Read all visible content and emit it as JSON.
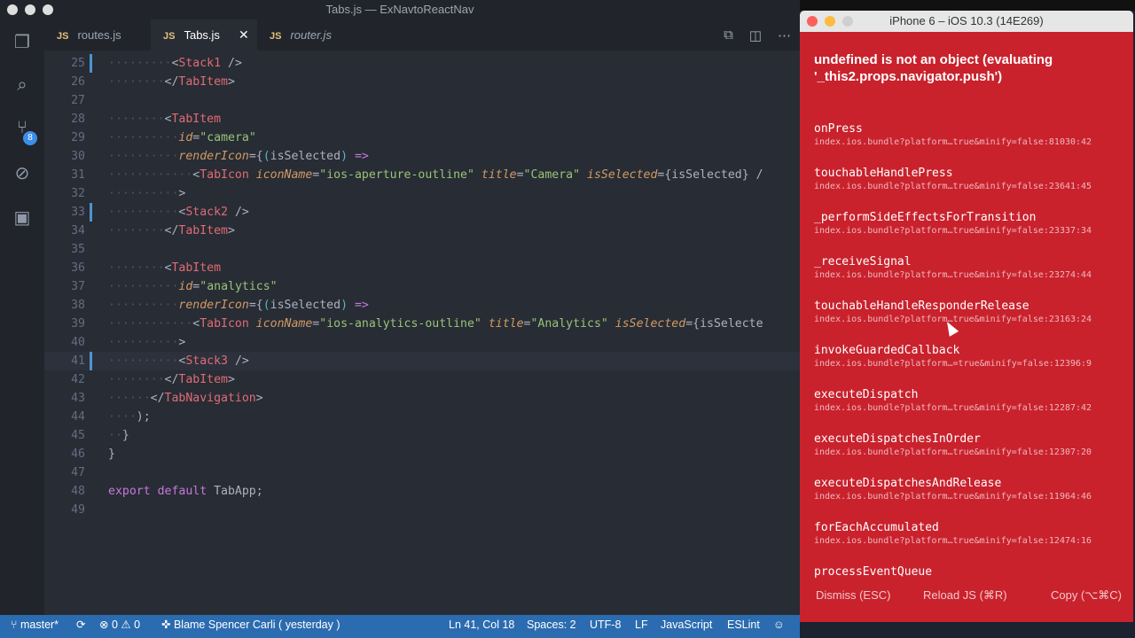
{
  "window_title": "Tabs.js — ExNavtoReactNav",
  "tabs": [
    {
      "label": "routes.js",
      "icon": "JS"
    },
    {
      "label": "Tabs.js",
      "icon": "JS"
    },
    {
      "label": "router.js",
      "icon": "JS"
    }
  ],
  "scm_badge": "8",
  "lines": [
    {
      "n": "25",
      "segs": [
        [
          "g",
          "·········"
        ],
        [
          "p",
          "<"
        ],
        [
          "t",
          "Stack1"
        ],
        [
          "p",
          " />"
        ]
      ]
    },
    {
      "n": "26",
      "segs": [
        [
          "g",
          "········"
        ],
        [
          "p",
          "</"
        ],
        [
          "t",
          "TabItem"
        ],
        [
          "p",
          ">"
        ]
      ]
    },
    {
      "n": "27",
      "segs": []
    },
    {
      "n": "28",
      "segs": [
        [
          "g",
          "········"
        ],
        [
          "p",
          "<"
        ],
        [
          "t",
          "TabItem"
        ]
      ]
    },
    {
      "n": "29",
      "segs": [
        [
          "g",
          "··········"
        ],
        [
          "a",
          "id"
        ],
        [
          "p",
          "="
        ],
        [
          "s",
          "\"camera\""
        ]
      ]
    },
    {
      "n": "30",
      "segs": [
        [
          "g",
          "··········"
        ],
        [
          "a",
          "renderIcon"
        ],
        [
          "p",
          "={"
        ],
        [
          "w",
          "("
        ],
        [
          "p",
          "isSelected"
        ],
        [
          "w",
          ")"
        ],
        [
          "k",
          " =>"
        ]
      ]
    },
    {
      "n": "31",
      "segs": [
        [
          "g",
          "············"
        ],
        [
          "p",
          "<"
        ],
        [
          "t",
          "TabIcon"
        ],
        [
          "p",
          " "
        ],
        [
          "a",
          "iconName"
        ],
        [
          "p",
          "="
        ],
        [
          "s",
          "\"ios-aperture-outline\""
        ],
        [
          "p",
          " "
        ],
        [
          "a",
          "title"
        ],
        [
          "p",
          "="
        ],
        [
          "s",
          "\"Camera\""
        ],
        [
          "p",
          " "
        ],
        [
          "a",
          "isSelected"
        ],
        [
          "p",
          "={isSelected} /"
        ]
      ]
    },
    {
      "n": "32",
      "segs": [
        [
          "g",
          "··········"
        ],
        [
          "p",
          ">"
        ]
      ]
    },
    {
      "n": "33",
      "segs": [
        [
          "g",
          "··········"
        ],
        [
          "p",
          "<"
        ],
        [
          "t",
          "Stack2"
        ],
        [
          "p",
          " />"
        ]
      ]
    },
    {
      "n": "34",
      "segs": [
        [
          "g",
          "········"
        ],
        [
          "p",
          "</"
        ],
        [
          "t",
          "TabItem"
        ],
        [
          "p",
          ">"
        ]
      ]
    },
    {
      "n": "35",
      "segs": []
    },
    {
      "n": "36",
      "segs": [
        [
          "g",
          "········"
        ],
        [
          "p",
          "<"
        ],
        [
          "t",
          "TabItem"
        ]
      ]
    },
    {
      "n": "37",
      "segs": [
        [
          "g",
          "··········"
        ],
        [
          "a",
          "id"
        ],
        [
          "p",
          "="
        ],
        [
          "s",
          "\"analytics\""
        ]
      ]
    },
    {
      "n": "38",
      "segs": [
        [
          "g",
          "··········"
        ],
        [
          "a",
          "renderIcon"
        ],
        [
          "p",
          "={"
        ],
        [
          "w",
          "("
        ],
        [
          "p",
          "isSelected"
        ],
        [
          "w",
          ")"
        ],
        [
          "k",
          " =>"
        ]
      ]
    },
    {
      "n": "39",
      "segs": [
        [
          "g",
          "············"
        ],
        [
          "p",
          "<"
        ],
        [
          "t",
          "TabIcon"
        ],
        [
          "p",
          " "
        ],
        [
          "a",
          "iconName"
        ],
        [
          "p",
          "="
        ],
        [
          "s",
          "\"ios-analytics-outline\""
        ],
        [
          "p",
          " "
        ],
        [
          "a",
          "title"
        ],
        [
          "p",
          "="
        ],
        [
          "s",
          "\"Analytics\""
        ],
        [
          "p",
          " "
        ],
        [
          "a",
          "isSelected"
        ],
        [
          "p",
          "={isSelecte"
        ]
      ]
    },
    {
      "n": "40",
      "segs": [
        [
          "g",
          "··········"
        ],
        [
          "p",
          ">"
        ]
      ]
    },
    {
      "n": "41",
      "segs": [
        [
          "g",
          "··········"
        ],
        [
          "p",
          "<"
        ],
        [
          "t",
          "Stack3"
        ],
        [
          "p",
          " />"
        ]
      ]
    },
    {
      "n": "42",
      "segs": [
        [
          "g",
          "········"
        ],
        [
          "p",
          "</"
        ],
        [
          "t",
          "TabItem"
        ],
        [
          "p",
          ">"
        ]
      ]
    },
    {
      "n": "43",
      "segs": [
        [
          "g",
          "······"
        ],
        [
          "p",
          "</"
        ],
        [
          "t",
          "TabNavigation"
        ],
        [
          "p",
          ">"
        ]
      ]
    },
    {
      "n": "44",
      "segs": [
        [
          "g",
          "····"
        ],
        [
          "p",
          ");"
        ]
      ]
    },
    {
      "n": "45",
      "segs": [
        [
          "g",
          "··"
        ],
        [
          "p",
          "}"
        ]
      ]
    },
    {
      "n": "46",
      "segs": [
        [
          "p",
          "}"
        ]
      ]
    },
    {
      "n": "47",
      "segs": []
    },
    {
      "n": "48",
      "segs": [
        [
          "k",
          "export default"
        ],
        [
          "p",
          " TabApp;"
        ]
      ]
    },
    {
      "n": "49",
      "segs": []
    }
  ],
  "status": {
    "branch": "master*",
    "errors": "0",
    "warnings": "0",
    "blame": "Blame Spencer Carli ( yesterday )",
    "position": "Ln 41, Col 18",
    "spaces": "Spaces: 2",
    "encoding": "UTF-8",
    "eol": "LF",
    "language": "JavaScript",
    "linter": "ESLint"
  },
  "sim": {
    "title": "iPhone 6 – iOS 10.3 (14E269)",
    "error": "undefined is not an object (evaluating '_this2.props.navigator.push')",
    "frames": [
      {
        "name": "onPress",
        "loc": "index.ios.bundle?platform…true&minify=false:81030:42"
      },
      {
        "name": "touchableHandlePress",
        "loc": "index.ios.bundle?platform…true&minify=false:23641:45"
      },
      {
        "name": "_performSideEffectsForTransition",
        "loc": "index.ios.bundle?platform…true&minify=false:23337:34"
      },
      {
        "name": "_receiveSignal",
        "loc": "index.ios.bundle?platform…true&minify=false:23274:44"
      },
      {
        "name": "touchableHandleResponderRelease",
        "loc": "index.ios.bundle?platform…true&minify=false:23163:24"
      },
      {
        "name": "invokeGuardedCallback",
        "loc": "index.ios.bundle?platform…=true&minify=false:12396:9"
      },
      {
        "name": "executeDispatch",
        "loc": "index.ios.bundle?platform…true&minify=false:12287:42"
      },
      {
        "name": "executeDispatchesInOrder",
        "loc": "index.ios.bundle?platform…true&minify=false:12307:20"
      },
      {
        "name": "executeDispatchesAndRelease",
        "loc": "index.ios.bundle?platform…true&minify=false:11964:46"
      },
      {
        "name": "forEachAccumulated",
        "loc": "index.ios.bundle?platform…true&minify=false:12474:16"
      },
      {
        "name": "processEventQueue",
        "loc": ""
      }
    ],
    "buttons": {
      "dismiss": "Dismiss (ESC)",
      "reload": "Reload JS (⌘R)",
      "copy": "Copy (⌥⌘C)"
    }
  }
}
